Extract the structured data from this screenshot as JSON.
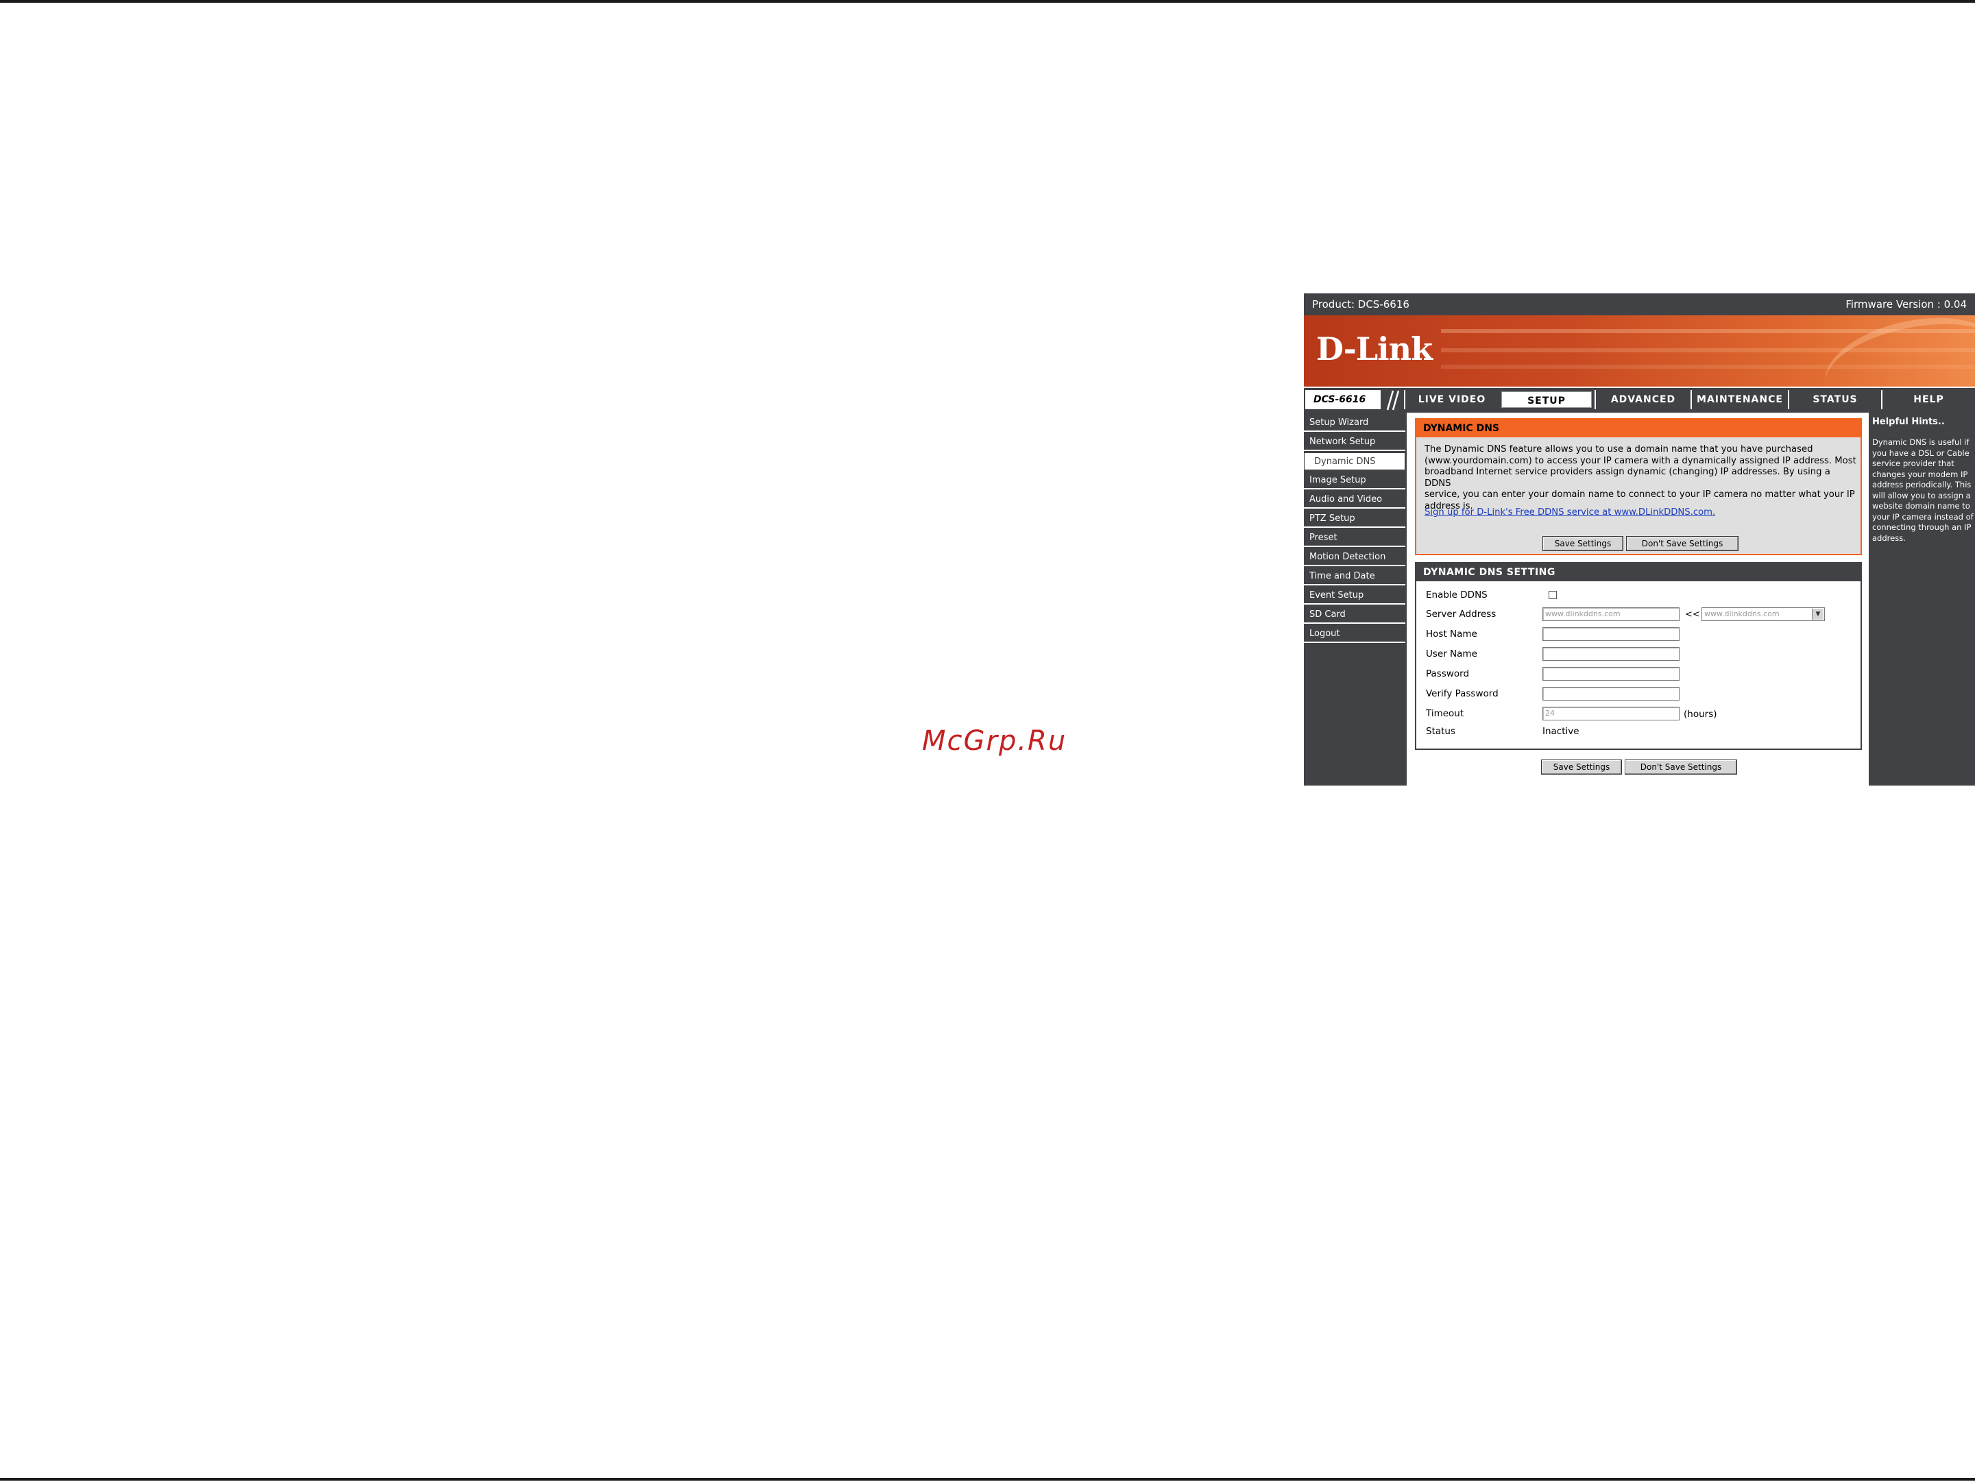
{
  "watermark": "McGrp.Ru",
  "header": {
    "product": "Product: DCS-6616",
    "firmware": "Firmware Version : 0.04",
    "logo": "D-Link"
  },
  "nav": {
    "model": "DCS-6616",
    "tabs": [
      {
        "label": "LIVE VIDEO"
      },
      {
        "label": "SETUP"
      },
      {
        "label": "ADVANCED"
      },
      {
        "label": "MAINTENANCE"
      },
      {
        "label": "STATUS"
      },
      {
        "label": "HELP"
      }
    ]
  },
  "sidebar": {
    "items": [
      {
        "label": "Setup Wizard"
      },
      {
        "label": "Network Setup"
      },
      {
        "label": "Dynamic DNS"
      },
      {
        "label": "Image Setup"
      },
      {
        "label": "Audio and Video"
      },
      {
        "label": "PTZ Setup"
      },
      {
        "label": "Preset"
      },
      {
        "label": "Motion Detection"
      },
      {
        "label": "Time and Date"
      },
      {
        "label": "Event Setup"
      },
      {
        "label": "SD Card"
      },
      {
        "label": "Logout"
      }
    ]
  },
  "ddns": {
    "title": "DYNAMIC DNS",
    "description_lines": [
      "The Dynamic DNS feature allows you to use a domain name that you have purchased",
      "(www.yourdomain.com) to access your IP camera with a dynamically assigned IP address. Most",
      "broadband Internet service providers assign dynamic (changing) IP addresses. By using a DDNS",
      "service, you can enter your domain name to connect to your IP camera no matter what your IP",
      "address is."
    ],
    "signup_link": "Sign up for D-Link's Free DDNS service at www.DLinkDDNS.com.",
    "save_label": "Save Settings",
    "dont_save_label": "Don't Save Settings"
  },
  "settings": {
    "title": "DYNAMIC DNS SETTING",
    "enable_label": "Enable DDNS",
    "server_label": "Server Address",
    "server_value": "www.dlinkddns.com",
    "server_arrows": "<<",
    "server_select": "www.dlinkddns.com",
    "host_label": "Host Name",
    "user_label": "User Name",
    "password_label": "Password",
    "verify_label": "Verify Password",
    "timeout_label": "Timeout",
    "timeout_value": "24",
    "timeout_unit": "(hours)",
    "status_label": "Status",
    "status_value": "Inactive",
    "save_label": "Save Settings",
    "dont_save_label": "Don't Save Settings"
  },
  "help": {
    "title": "Helpful Hints..",
    "lines": [
      "Dynamic DNS is useful if",
      "you have a DSL or Cable",
      "service provider that",
      "changes your modem IP",
      "address periodically. This",
      "will allow you to assign a",
      "website domain name to",
      "your IP camera instead of",
      "connecting through an IP",
      "address."
    ]
  }
}
